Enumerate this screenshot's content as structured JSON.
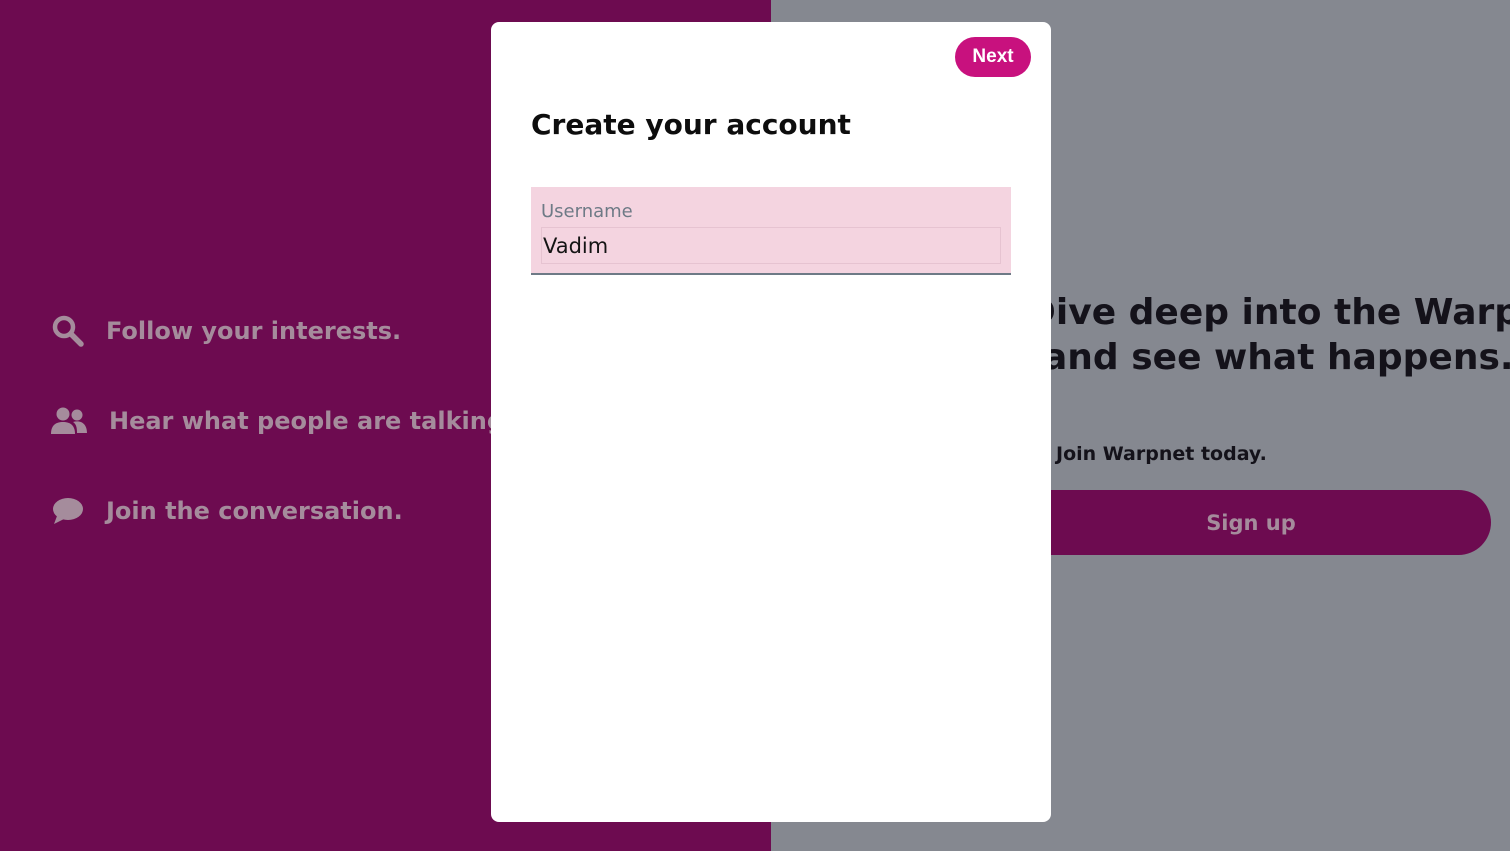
{
  "left_panel": {
    "features": [
      {
        "icon": "search-icon",
        "label": "Follow your interests."
      },
      {
        "icon": "people-icon",
        "label": "Hear what people are talking about."
      },
      {
        "icon": "chat-bubble-icon",
        "label": "Join the conversation."
      }
    ],
    "background_color": "#6d0b50"
  },
  "right_panel": {
    "headline_line1": "Dive deep into the Warp",
    "headline_line2": "and see what happens...",
    "join_text": "Join Warpnet today.",
    "signup_label": "Sign up",
    "background_color": "#858890"
  },
  "modal": {
    "next_label": "Next",
    "title": "Create your account",
    "username": {
      "label": "Username",
      "value": "Vadim"
    },
    "accent_color": "#c8117e"
  }
}
